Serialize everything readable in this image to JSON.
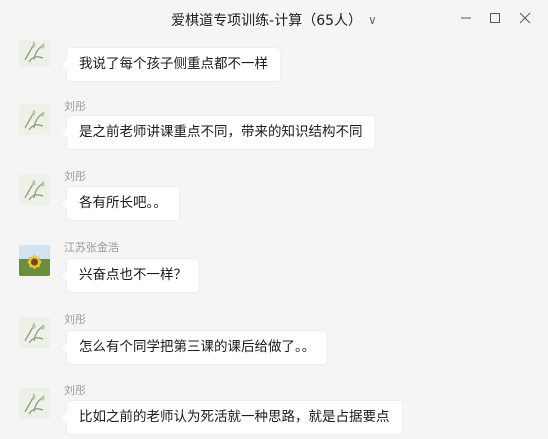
{
  "window": {
    "title": "爱棋道专项训练-计算（65人）",
    "title_chevron": "∨",
    "minimize_glyph": "—",
    "maximize_glyph": "□",
    "close_glyph": "✕"
  },
  "messages": [
    {
      "sender": "",
      "text": "我说了每个孩子侧重点都不一样",
      "avatar": "plant-avatar"
    },
    {
      "sender": "刘彤",
      "text": "是之前老师讲课重点不同，带来的知识结构不同",
      "avatar": "plant-avatar"
    },
    {
      "sender": "刘彤",
      "text": "各有所长吧。。",
      "avatar": "plant-avatar"
    },
    {
      "sender": "江苏张金浩",
      "text": "兴奋点也不一样？",
      "avatar": "sunflower-avatar"
    },
    {
      "sender": "刘彤",
      "text": "怎么有个同学把第三课的课后给做了。。",
      "avatar": "plant-avatar"
    },
    {
      "sender": "刘彤",
      "text": "比如之前的老师认为死活就一种思路，就是占据要点",
      "avatar": "plant-avatar"
    }
  ]
}
